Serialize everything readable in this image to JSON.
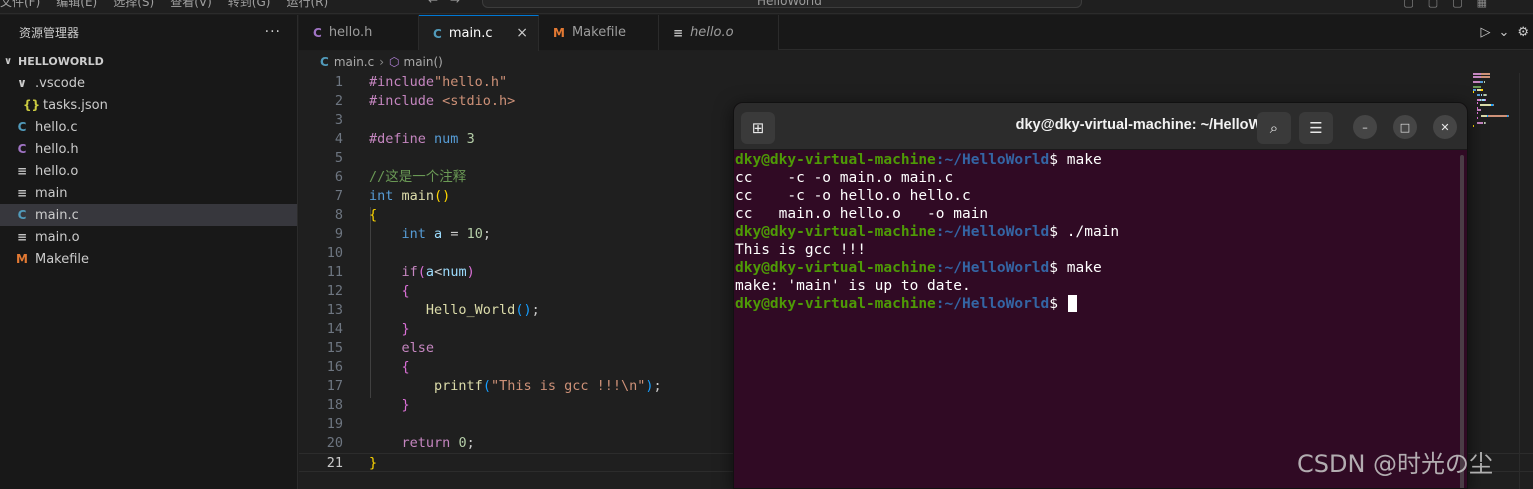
{
  "menubar": {
    "menus": [
      "文件(F)",
      "编辑(E)",
      "选择(S)",
      "查看(V)",
      "转到(G)",
      "运行(R)"
    ],
    "nav": "← →",
    "command_center": "HelloWorld"
  },
  "sidebar": {
    "title": "资源管理器",
    "more": "···",
    "section": "HELLOWORLD",
    "items": [
      {
        "label": ".vscode",
        "icon": "chevron-down-icon",
        "glyph": "∨",
        "indent": 1,
        "kind": "folder"
      },
      {
        "label": "tasks.json",
        "icon": "json-icon",
        "glyph": "{}",
        "indent": 2,
        "kind": "json"
      },
      {
        "label": "hello.c",
        "icon": "c-file-icon",
        "glyph": "C",
        "indent": 1,
        "kind": "c"
      },
      {
        "label": "hello.h",
        "icon": "h-file-icon",
        "glyph": "C",
        "indent": 1,
        "kind": "h"
      },
      {
        "label": "hello.o",
        "icon": "object-file-icon",
        "glyph": "≡",
        "indent": 1,
        "kind": "o"
      },
      {
        "label": "main",
        "icon": "binary-file-icon",
        "glyph": "≡",
        "indent": 1,
        "kind": "o"
      },
      {
        "label": "main.c",
        "icon": "c-file-icon",
        "glyph": "C",
        "indent": 1,
        "kind": "c",
        "selected": true
      },
      {
        "label": "main.o",
        "icon": "object-file-icon",
        "glyph": "≡",
        "indent": 1,
        "kind": "o"
      },
      {
        "label": "Makefile",
        "icon": "makefile-icon",
        "glyph": "M",
        "indent": 1,
        "kind": "m"
      }
    ]
  },
  "tabs": [
    {
      "label": "hello.h",
      "glyph": "C",
      "kind": "h",
      "active": false,
      "italic": false
    },
    {
      "label": "main.c",
      "glyph": "C",
      "kind": "c",
      "active": true,
      "italic": false,
      "close": "×"
    },
    {
      "label": "Makefile",
      "glyph": "M",
      "kind": "m",
      "active": false,
      "italic": false
    },
    {
      "label": "hello.o",
      "glyph": "≡",
      "kind": "o",
      "active": false,
      "italic": true
    }
  ],
  "tab_actions": {
    "run": "▷",
    "run_dropdown": "⌄",
    "settings": "⚙"
  },
  "breadcrumb": {
    "file": "main.c",
    "symbol": "main()"
  },
  "editor": {
    "current_line": 21,
    "lines": [
      [
        [
          "pp",
          "#include"
        ],
        [
          "str",
          "\"hello.h\""
        ]
      ],
      [
        [
          "pp",
          "#include "
        ],
        [
          "str",
          "<stdio.h>"
        ]
      ],
      [],
      [
        [
          "pp",
          "#define "
        ],
        [
          "kw",
          "num"
        ],
        [
          "plain",
          " "
        ],
        [
          "num",
          "3"
        ]
      ],
      [],
      [
        [
          "cmt",
          "//这是一个注释"
        ]
      ],
      [
        [
          "kw",
          "int"
        ],
        [
          "plain",
          " "
        ],
        [
          "fn",
          "main"
        ],
        [
          "br1",
          "()"
        ]
      ],
      [
        [
          "br1",
          "{"
        ]
      ],
      [
        [
          "plain",
          "    "
        ],
        [
          "kw",
          "int"
        ],
        [
          "plain",
          " "
        ],
        [
          "var",
          "a"
        ],
        [
          "plain",
          " = "
        ],
        [
          "num",
          "10"
        ],
        [
          "plain",
          ";"
        ]
      ],
      [],
      [
        [
          "plain",
          "    "
        ],
        [
          "pp",
          "if"
        ],
        [
          "br2",
          "("
        ],
        [
          "var",
          "a"
        ],
        [
          "plain",
          "<"
        ],
        [
          "var",
          "num"
        ],
        [
          "br2",
          ")"
        ]
      ],
      [
        [
          "plain",
          "    "
        ],
        [
          "br2",
          "{"
        ]
      ],
      [
        [
          "plain",
          "       "
        ],
        [
          "fn",
          "Hello_World"
        ],
        [
          "br3",
          "()"
        ],
        [
          "plain",
          ";"
        ]
      ],
      [
        [
          "plain",
          "    "
        ],
        [
          "br2",
          "}"
        ]
      ],
      [
        [
          "plain",
          "    "
        ],
        [
          "pp",
          "else"
        ]
      ],
      [
        [
          "plain",
          "    "
        ],
        [
          "br2",
          "{"
        ]
      ],
      [
        [
          "plain",
          "        "
        ],
        [
          "fn",
          "printf"
        ],
        [
          "br3",
          "("
        ],
        [
          "str",
          "\"This is gcc !!!\\n\""
        ],
        [
          "br3",
          ")"
        ],
        [
          "plain",
          ";"
        ]
      ],
      [
        [
          "plain",
          "    "
        ],
        [
          "br2",
          "}"
        ]
      ],
      [],
      [
        [
          "plain",
          "    "
        ],
        [
          "pp",
          "return"
        ],
        [
          "plain",
          " "
        ],
        [
          "num",
          "0"
        ],
        [
          "plain",
          ";"
        ]
      ],
      [
        [
          "br1",
          "}"
        ]
      ]
    ]
  },
  "terminal": {
    "title": "dky@dky-virtual-machine: ~/HelloWorld",
    "buttons": {
      "new_tab": "⊞",
      "search": "⌕",
      "menu": "☰",
      "minimize": "–",
      "maximize": "□",
      "close": "✕"
    },
    "prompt_user": "dky@dky-virtual-machine",
    "prompt_path": ":~/HelloWorld",
    "lines": [
      {
        "type": "prompt",
        "cmd": "$ make"
      },
      {
        "type": "out",
        "text": "cc    -c -o main.o main.c"
      },
      {
        "type": "out",
        "text": "cc    -c -o hello.o hello.c"
      },
      {
        "type": "out",
        "text": "cc   main.o hello.o   -o main"
      },
      {
        "type": "prompt",
        "cmd": "$ ./main"
      },
      {
        "type": "out",
        "text": "This is gcc !!!"
      },
      {
        "type": "prompt",
        "cmd": "$ make"
      },
      {
        "type": "out",
        "text": "make: 'main' is up to date."
      },
      {
        "type": "prompt",
        "cmd": "$ ",
        "cursor": true
      }
    ]
  },
  "watermark": "CSDN @时光の尘",
  "colors": {
    "editor_bg": "#1f1f1f",
    "sidebar_bg": "#181818",
    "terminal_bg": "#300a24",
    "prompt_user": "#4e9a06",
    "prompt_path": "#3465a4",
    "accent": "#0078d4"
  }
}
